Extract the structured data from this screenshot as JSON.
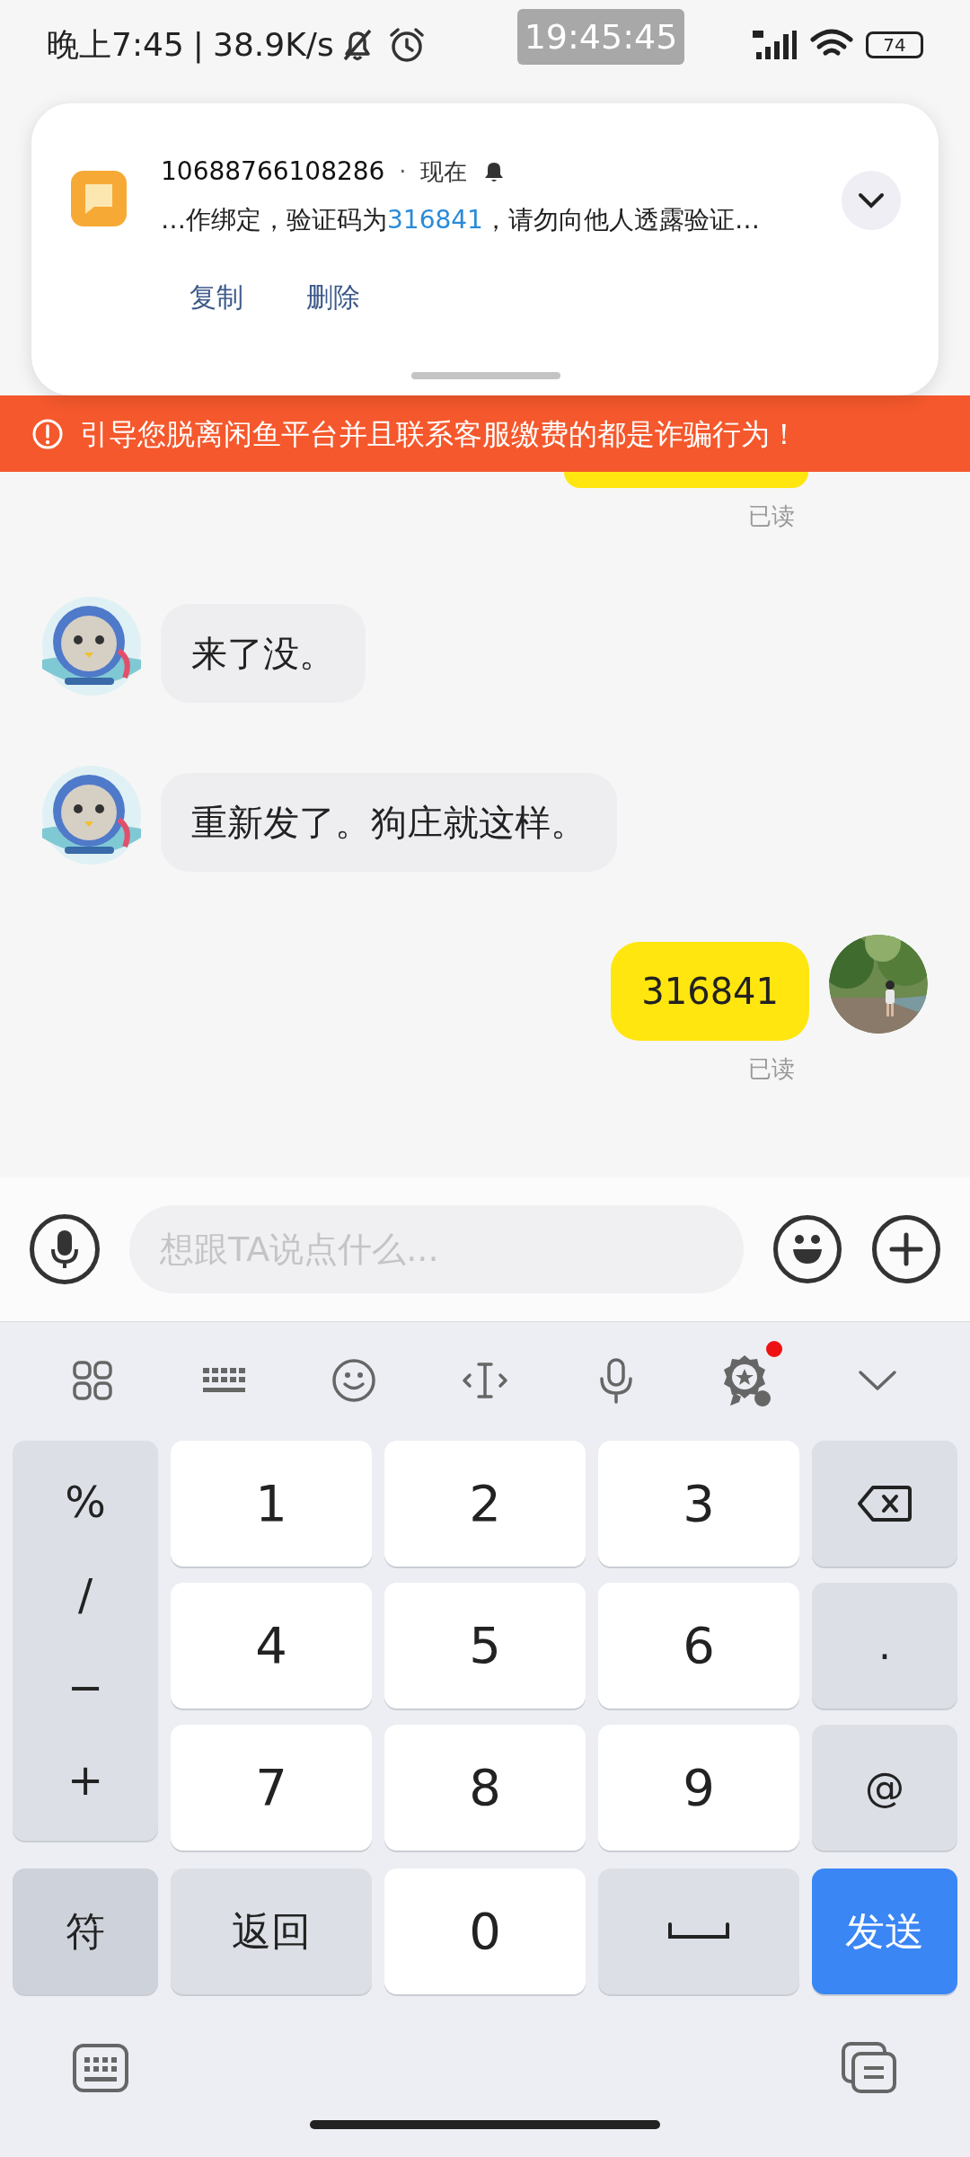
{
  "status_bar": {
    "time": "晚上7:45",
    "separator": "|",
    "speed": "38.9K/s",
    "clock_overlay": "19:45:45",
    "battery": "74"
  },
  "notification": {
    "sender": "10688766108286",
    "dot": "·",
    "time": "现在",
    "message_before": "…作绑定，验证码为",
    "code": "316841",
    "message_after": "，请勿向他人透露验证…",
    "actions": [
      "复制",
      "删除"
    ]
  },
  "warning_banner": {
    "text": "引导您脱离闲鱼平台并且联系客服缴费的都是诈骗行为！"
  },
  "messages": [
    {
      "kind": "partial",
      "receipt": "已读"
    },
    {
      "kind": "received",
      "text": "来了没。"
    },
    {
      "kind": "received",
      "text": "重新发了。狗庄就这样。"
    },
    {
      "kind": "sent",
      "text": "316841",
      "receipt": "已读"
    }
  ],
  "composer": {
    "placeholder": "想跟TA说点什么..."
  },
  "keyboard": {
    "toolbar": [
      {
        "kind": "grid",
        "badge": false
      },
      {
        "kind": "keyboard",
        "badge": false
      },
      {
        "kind": "emoji",
        "badge": false
      },
      {
        "kind": "cursor",
        "badge": false
      },
      {
        "kind": "mic",
        "badge": false
      },
      {
        "kind": "award",
        "badge": true
      },
      {
        "kind": "collapse",
        "badge": false
      }
    ],
    "symbols": [
      "%",
      "/",
      "−",
      "+"
    ],
    "rows": [
      [
        {
          "kind": "digit",
          "label": "1"
        },
        {
          "kind": "digit",
          "label": "2"
        },
        {
          "kind": "digit",
          "label": "3"
        },
        {
          "kind": "backspace"
        }
      ],
      [
        {
          "kind": "digit",
          "label": "4"
        },
        {
          "kind": "digit",
          "label": "5"
        },
        {
          "kind": "digit",
          "label": "6"
        },
        {
          "kind": "function",
          "label": "."
        }
      ],
      [
        {
          "kind": "digit",
          "label": "7"
        },
        {
          "kind": "digit",
          "label": "8"
        },
        {
          "kind": "digit",
          "label": "9"
        },
        {
          "kind": "function",
          "label": "@"
        }
      ]
    ],
    "bottom_row": [
      {
        "kind": "mode",
        "label": "符"
      },
      {
        "kind": "function",
        "label": "返回"
      },
      {
        "kind": "digit",
        "label": "0"
      },
      {
        "kind": "space"
      },
      {
        "kind": "send",
        "label": "发送"
      }
    ]
  }
}
